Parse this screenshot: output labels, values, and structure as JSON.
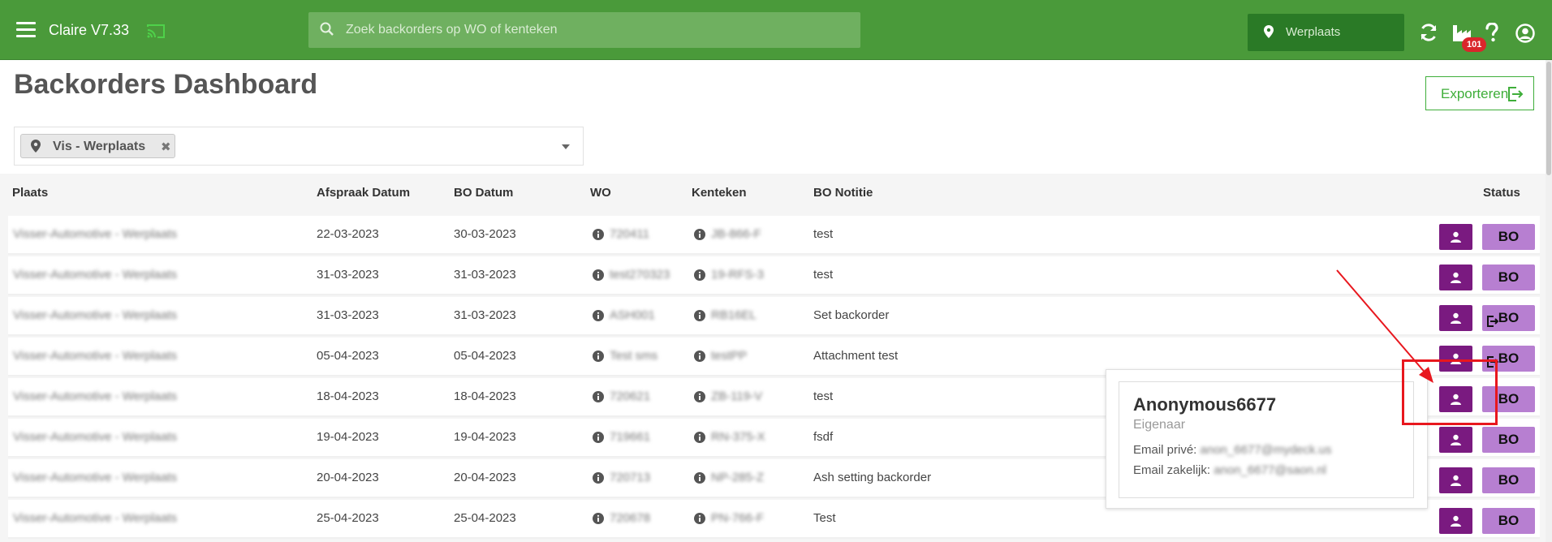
{
  "topbar": {
    "app_title": "Claire V7.33",
    "search_placeholder": "Zoek backorders op WO of kenteken",
    "location_label": "Werplaats",
    "badge_count": "101",
    "colors": {
      "bar": "#4a9a3a",
      "location_bg": "#2a7a26"
    }
  },
  "page": {
    "title": "Backorders Dashboard",
    "export_label": "Exporteren"
  },
  "filter": {
    "chip_label": "Vis - Werplaats"
  },
  "table": {
    "headers": {
      "plaats": "Plaats",
      "afspraak": "Afspraak Datum",
      "bo_datum": "BO Datum",
      "wo": "WO",
      "kenteken": "Kenteken",
      "notitie": "BO Notitie",
      "status": "Status"
    },
    "rows": [
      {
        "plaats": "Visser-Automotive - Werplaats",
        "afspraak": "22-03-2023",
        "bo_datum": "30-03-2023",
        "wo": "720411",
        "kenteken": "JB-866-F",
        "notitie": "test",
        "status": "BO"
      },
      {
        "plaats": "Visser-Automotive - Werplaats",
        "afspraak": "31-03-2023",
        "bo_datum": "31-03-2023",
        "wo": "test270323",
        "kenteken": "19-RFS-3",
        "notitie": "test",
        "status": "BO"
      },
      {
        "plaats": "Visser-Automotive - Werplaats",
        "afspraak": "31-03-2023",
        "bo_datum": "31-03-2023",
        "wo": "ASH001",
        "kenteken": "RB16EL",
        "notitie": "Set backorder",
        "status": "BO"
      },
      {
        "plaats": "Visser-Automotive - Werplaats",
        "afspraak": "05-04-2023",
        "bo_datum": "05-04-2023",
        "wo": "Test sms",
        "kenteken": "testPP",
        "notitie": "Attachment test",
        "status": "BO"
      },
      {
        "plaats": "Visser-Automotive - Werplaats",
        "afspraak": "18-04-2023",
        "bo_datum": "18-04-2023",
        "wo": "720621",
        "kenteken": "ZB-119-V",
        "notitie": "test",
        "status": "BO"
      },
      {
        "plaats": "Visser-Automotive - Werplaats",
        "afspraak": "19-04-2023",
        "bo_datum": "19-04-2023",
        "wo": "719661",
        "kenteken": "RN-375-X",
        "notitie": "fsdf",
        "status": "BO"
      },
      {
        "plaats": "Visser-Automotive - Werplaats",
        "afspraak": "20-04-2023",
        "bo_datum": "20-04-2023",
        "wo": "720713",
        "kenteken": "NP-285-Z",
        "notitie": "Ash setting backorder",
        "status": "BO"
      },
      {
        "plaats": "Visser-Automotive - Werplaats",
        "afspraak": "25-04-2023",
        "bo_datum": "25-04-2023",
        "wo": "720678",
        "kenteken": "PN-766-F",
        "notitie": "Test",
        "status": "BO"
      }
    ]
  },
  "popover": {
    "name": "Anonymous6677",
    "role": "Eigenaar",
    "email_private_label": "Email privé:",
    "email_private": "anon_6677@mydeck.us",
    "email_business_label": "Email zakelijk:",
    "email_business": "anon_6677@saon.nl"
  }
}
